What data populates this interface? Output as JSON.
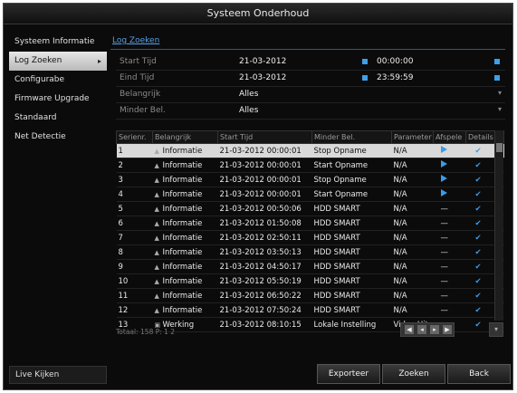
{
  "window": {
    "title": "Systeem Onderhoud"
  },
  "sidebar": {
    "items": [
      {
        "label": "Systeem Informatie"
      },
      {
        "label": "Log Zoeken"
      },
      {
        "label": "Configurabe"
      },
      {
        "label": "Firmware Upgrade"
      },
      {
        "label": "Standaard"
      },
      {
        "label": "Net Detectie"
      }
    ],
    "live_label": "Live Kijken"
  },
  "main": {
    "tab": "Log Zoeken",
    "form": {
      "start_label": "Start Tijd",
      "start_date": "21-03-2012",
      "start_time": "00:00:00",
      "end_label": "Eind Tijd",
      "end_date": "21-03-2012",
      "end_time": "23:59:59",
      "major_label": "Belangrijk",
      "major_value": "Alles",
      "minor_label": "Minder Bel.",
      "minor_value": "Alles"
    },
    "columns": [
      "Serienr.",
      "Belangrijk",
      "Start Tijd",
      "Minder Bel.",
      "Parameter",
      "Afspele",
      "Details"
    ],
    "rows": [
      {
        "no": "1",
        "major": "Informatie",
        "time": "21-03-2012 00:00:01",
        "minor": "Stop Opname",
        "param": "N/A",
        "play": "play",
        "details": "check",
        "icon": "info-icon"
      },
      {
        "no": "2",
        "major": "Informatie",
        "time": "21-03-2012 00:00:01",
        "minor": "Start Opname",
        "param": "N/A",
        "play": "play",
        "details": "check",
        "icon": "info-icon"
      },
      {
        "no": "3",
        "major": "Informatie",
        "time": "21-03-2012 00:00:01",
        "minor": "Stop Opname",
        "param": "N/A",
        "play": "play",
        "details": "check",
        "icon": "info-icon"
      },
      {
        "no": "4",
        "major": "Informatie",
        "time": "21-03-2012 00:00:01",
        "minor": "Start Opname",
        "param": "N/A",
        "play": "play",
        "details": "check",
        "icon": "info-icon"
      },
      {
        "no": "5",
        "major": "Informatie",
        "time": "21-03-2012 00:50:06",
        "minor": "HDD SMART",
        "param": "N/A",
        "play": "dash",
        "details": "check",
        "icon": "info-icon"
      },
      {
        "no": "6",
        "major": "Informatie",
        "time": "21-03-2012 01:50:08",
        "minor": "HDD SMART",
        "param": "N/A",
        "play": "dash",
        "details": "check",
        "icon": "info-icon"
      },
      {
        "no": "7",
        "major": "Informatie",
        "time": "21-03-2012 02:50:11",
        "minor": "HDD SMART",
        "param": "N/A",
        "play": "dash",
        "details": "check",
        "icon": "info-icon"
      },
      {
        "no": "8",
        "major": "Informatie",
        "time": "21-03-2012 03:50:13",
        "minor": "HDD SMART",
        "param": "N/A",
        "play": "dash",
        "details": "check",
        "icon": "info-icon"
      },
      {
        "no": "9",
        "major": "Informatie",
        "time": "21-03-2012 04:50:17",
        "minor": "HDD SMART",
        "param": "N/A",
        "play": "dash",
        "details": "check",
        "icon": "info-icon"
      },
      {
        "no": "10",
        "major": "Informatie",
        "time": "21-03-2012 05:50:19",
        "minor": "HDD SMART",
        "param": "N/A",
        "play": "dash",
        "details": "check",
        "icon": "info-icon"
      },
      {
        "no": "11",
        "major": "Informatie",
        "time": "21-03-2012 06:50:22",
        "minor": "HDD SMART",
        "param": "N/A",
        "play": "dash",
        "details": "check",
        "icon": "info-icon"
      },
      {
        "no": "12",
        "major": "Informatie",
        "time": "21-03-2012 07:50:24",
        "minor": "HDD SMART",
        "param": "N/A",
        "play": "dash",
        "details": "check",
        "icon": "info-icon"
      },
      {
        "no": "13",
        "major": "Werking",
        "time": "21-03-2012 08:10:15",
        "minor": "Lokale Instelling",
        "param": "Video Uitg",
        "play": "dash",
        "details": "check",
        "icon": "operation-icon"
      }
    ],
    "footer_text": "Totaal: 158  P: 1 2"
  },
  "buttons": {
    "export": "Exporteer",
    "search": "Zoeken",
    "back": "Back"
  },
  "colors": {
    "accent": "#3c9be8",
    "background": "#0b0b0b",
    "selection": "#d9d9d9"
  }
}
